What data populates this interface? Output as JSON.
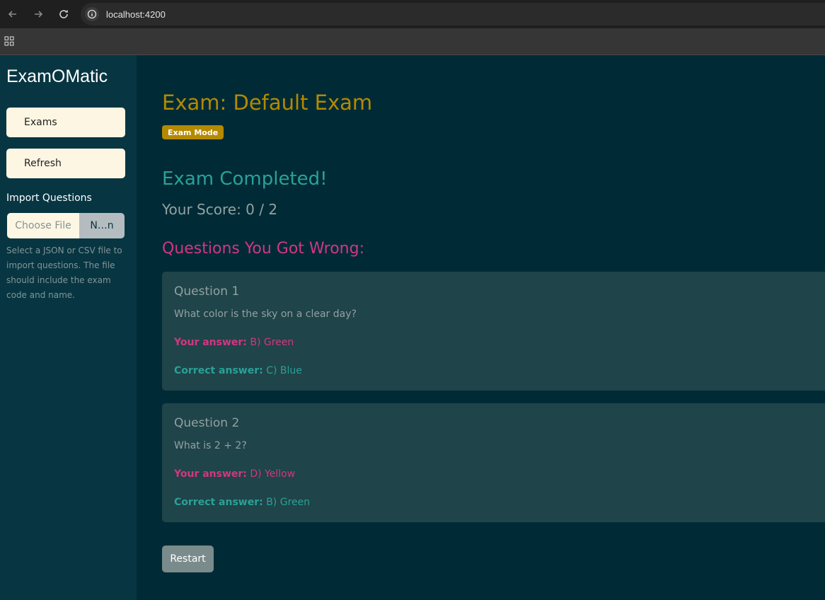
{
  "browser": {
    "url": "localhost:4200",
    "icons": [
      "back-icon",
      "forward-icon",
      "reload-icon",
      "info-icon",
      "apps-icon"
    ]
  },
  "sidebar": {
    "brand": "ExamOMatic",
    "buttons": [
      {
        "label": "Exams"
      },
      {
        "label": "Refresh"
      }
    ],
    "import_label": "Import Questions",
    "file_input": {
      "choose_label": "Choose File",
      "file_name": "N…n"
    },
    "help_text": "Select a JSON or CSV file to import questions. The file should include the exam code and name."
  },
  "main": {
    "exam_title": "Exam: Default Exam",
    "mode_badge": "Exam Mode",
    "completed_heading": "Exam Completed!",
    "score_text": "Your Score: 0 / 2",
    "wrong_heading": "Questions You Got Wrong:",
    "your_answer_label": "Your answer:",
    "correct_answer_label": "Correct answer:",
    "questions": [
      {
        "title": "Question 1",
        "text": "What color is the sky on a clear day?",
        "your_answer": "B) Green",
        "correct_answer": "C) Blue"
      },
      {
        "title": "Question 2",
        "text": "What is 2 + 2?",
        "your_answer": "D) Yellow",
        "correct_answer": "B) Green"
      }
    ],
    "restart_label": "Restart"
  },
  "colors": {
    "background": "#002b36",
    "sidebar": "#073642",
    "title": "#b58900",
    "success": "#2aa198",
    "error": "#d33682",
    "card": "#1f4449"
  }
}
